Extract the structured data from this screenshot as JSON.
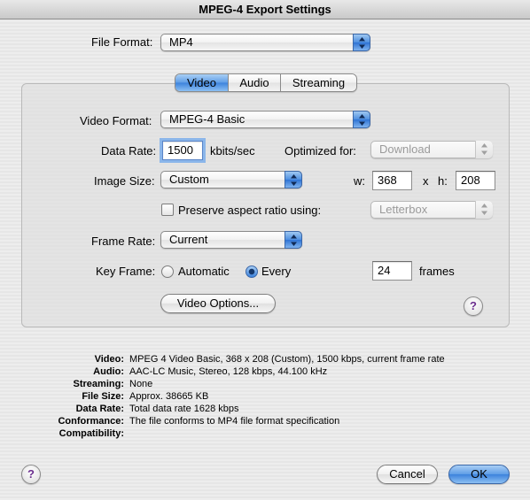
{
  "window": {
    "title": "MPEG-4 Export Settings"
  },
  "file_format": {
    "label": "File Format:",
    "value": "MP4"
  },
  "tabs": [
    {
      "label": "Video"
    },
    {
      "label": "Audio"
    },
    {
      "label": "Streaming"
    }
  ],
  "video": {
    "format_label": "Video Format:",
    "format_value": "MPEG-4 Basic",
    "data_rate_label": "Data Rate:",
    "data_rate_value": "1500",
    "data_rate_unit": "kbits/sec",
    "optimized_label": "Optimized for:",
    "optimized_value": "Download",
    "image_size_label": "Image Size:",
    "image_size_value": "Custom",
    "w_label": "w:",
    "w_value": "368",
    "x_label": "x",
    "h_label": "h:",
    "h_value": "208",
    "preserve_label": "Preserve aspect ratio using:",
    "preserve_value": "Letterbox",
    "frame_rate_label": "Frame Rate:",
    "frame_rate_value": "Current",
    "key_frame_label": "Key Frame:",
    "key_automatic_label": "Automatic",
    "key_every_label": "Every",
    "key_frames_value": "24",
    "key_frames_unit": "frames",
    "options_button": "Video Options..."
  },
  "summary": [
    {
      "key": "Video:",
      "value": "MPEG 4 Video Basic, 368 x 208 (Custom), 1500 kbps, current frame rate"
    },
    {
      "key": "Audio:",
      "value": "AAC-LC Music, Stereo, 128 kbps, 44.100 kHz"
    },
    {
      "key": "Streaming:",
      "value": "None"
    },
    {
      "key": "File Size:",
      "value": "Approx. 38665 KB"
    },
    {
      "key": "Data Rate:",
      "value": "Total data rate 1628 kbps"
    },
    {
      "key": "Conformance:",
      "value": "The file conforms to MP4 file format specification"
    },
    {
      "key": "Compatibility:",
      "value": ""
    }
  ],
  "buttons": {
    "cancel": "Cancel",
    "ok": "OK",
    "help": "?"
  }
}
